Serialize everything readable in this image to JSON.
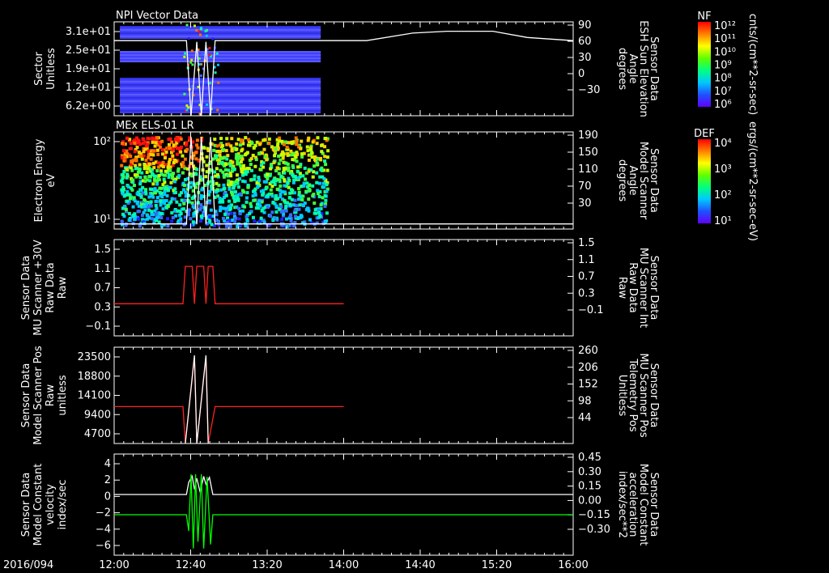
{
  "date_label": "2016/094",
  "x_ticks": [
    "12:00",
    "12:40",
    "13:20",
    "14:00",
    "14:40",
    "15:20",
    "16:00"
  ],
  "colors": {
    "white": "#ffffff",
    "red": "#ff2020",
    "green": "#00ff00"
  },
  "colorbars": [
    {
      "title": "NF",
      "ticks": [
        "10¹²",
        "10¹¹",
        "10¹⁰",
        "10⁹",
        "10⁸",
        "10⁷",
        "10⁶"
      ],
      "units": "cnts/(cm**2-sr-sec)"
    },
    {
      "title": "DEF",
      "ticks": [
        "10⁴",
        "10³",
        "10²",
        "10¹"
      ],
      "units": "ergs/(cm**2-sr-sec-eV)"
    }
  ],
  "chart_data": [
    {
      "type": "heatmap",
      "title": "NPI Vector Data",
      "ylabel": [
        "Sector",
        "Unitless"
      ],
      "yticks": [
        "3.1e+01",
        "2.5e+01",
        "1.9e+01",
        "1.2e+01",
        "6.2e+00"
      ],
      "ylabel_right": [
        "Sensor Data",
        "ESH Sun Elevation",
        "Angle",
        "degrees"
      ],
      "yticks_right": [
        "90",
        "60",
        "30",
        "0",
        "−30"
      ],
      "ylim_right": [
        -60,
        90
      ],
      "overlay_right": {
        "color": "white",
        "points": [
          [
            12,
            60
          ],
          [
            12.63,
            60
          ],
          [
            12.67,
            -60
          ],
          [
            12.72,
            58
          ],
          [
            12.76,
            -60
          ],
          [
            12.8,
            58
          ],
          [
            12.84,
            -60
          ],
          [
            12.88,
            60
          ],
          [
            14.2,
            60
          ],
          [
            14.6,
            72
          ],
          [
            14.9,
            75
          ],
          [
            15.3,
            75
          ],
          [
            15.6,
            65
          ],
          [
            16,
            60
          ]
        ]
      },
      "data_extent": [
        12.05,
        13.8
      ]
    },
    {
      "type": "heatmap",
      "title": "MEx ELS-01 LR",
      "ylabel": [
        "Electron Energy",
        "eV"
      ],
      "yticks": [
        "10²",
        "10¹"
      ],
      "ylabel_right": [
        "Sensor Data",
        "Model Scanner",
        "Angle",
        "degrees"
      ],
      "yticks_right": [
        "190",
        "150",
        "110",
        "70",
        "30"
      ],
      "ylim_right": [
        0,
        190
      ],
      "overlay_right": {
        "color": "white",
        "points": [
          [
            12,
            10
          ],
          [
            12.63,
            10
          ],
          [
            12.67,
            180
          ],
          [
            12.72,
            10
          ],
          [
            12.76,
            180
          ],
          [
            12.8,
            10
          ],
          [
            12.84,
            180
          ],
          [
            12.88,
            10
          ],
          [
            16,
            10
          ]
        ]
      },
      "data_extent": [
        12.05,
        13.85
      ]
    },
    {
      "type": "line",
      "ylabel": [
        "Sensor Data",
        "MU Scanner +30V",
        "Raw Data",
        "Raw"
      ],
      "yticks": [
        "1.5",
        "1.1",
        "0.7",
        "0.3",
        "−0.1"
      ],
      "ylim": [
        -0.3,
        1.5
      ],
      "ylabel_right": [
        "Sensor Data",
        "MU Scanner Int",
        "Raw Data",
        "Raw"
      ],
      "yticks_right": [
        "1.5",
        "1.1",
        "0.7",
        "0.3",
        "−0.1"
      ],
      "label_right_color": "red",
      "series": [
        {
          "color": "red",
          "points": [
            [
              12,
              0.3
            ],
            [
              12.6,
              0.3
            ],
            [
              12.62,
              1.0
            ],
            [
              12.68,
              1.0
            ],
            [
              12.7,
              0.3
            ],
            [
              12.72,
              1.0
            ],
            [
              12.78,
              1.0
            ],
            [
              12.8,
              0.3
            ],
            [
              12.82,
              1.0
            ],
            [
              12.86,
              1.0
            ],
            [
              12.88,
              0.3
            ],
            [
              14,
              0.3
            ]
          ]
        }
      ]
    },
    {
      "type": "line",
      "ylabel": [
        "Sensor Data",
        "Model Scanner Pos",
        "Raw",
        "unitless"
      ],
      "yticks": [
        "23500",
        "18800",
        "14100",
        "9400",
        "4700"
      ],
      "ylim": [
        0,
        23500
      ],
      "ylabel_right": [
        "Sensor Data",
        "MU Scanner Pos",
        "Telemetry Pos",
        "Unitless"
      ],
      "yticks_right": [
        "260",
        "206",
        "152",
        "98",
        "44"
      ],
      "label_right_color": "red",
      "series": [
        {
          "color": "red",
          "points": [
            [
              12,
              9000
            ],
            [
              12.6,
              9000
            ],
            [
              12.62,
              0
            ],
            [
              12.7,
              21000
            ],
            [
              12.72,
              0
            ],
            [
              12.8,
              21000
            ],
            [
              12.82,
              0
            ],
            [
              12.88,
              9000
            ],
            [
              14,
              9000
            ]
          ]
        },
        {
          "color": "white",
          "points": [
            [
              12.62,
              0
            ],
            [
              12.7,
              21500
            ],
            [
              12.72,
              0
            ],
            [
              12.8,
              21500
            ],
            [
              12.82,
              0
            ]
          ]
        }
      ]
    },
    {
      "type": "line",
      "ylabel": [
        "Sensor Data",
        "Model Constant",
        "velocity",
        "index/sec"
      ],
      "yticks": [
        "4",
        "2",
        "0",
        "−2",
        "−4",
        "−6"
      ],
      "ylim": [
        -6,
        4
      ],
      "ylabel_right": [
        "Sensor Data",
        "Model Constant",
        "acceleration",
        "index/sec**2"
      ],
      "yticks_right": [
        "0.45",
        "0.30",
        "0.15",
        "0.00",
        "−0.15",
        "−0.30"
      ],
      "ylim_right": [
        -0.3,
        0.45
      ],
      "label_right_color": "green",
      "series": [
        {
          "color": "white",
          "points": [
            [
              12,
              0
            ],
            [
              12.63,
              0
            ],
            [
              12.65,
              1.2
            ],
            [
              12.68,
              1.8
            ],
            [
              12.7,
              0.5
            ],
            [
              12.72,
              1.6
            ],
            [
              12.75,
              0.2
            ],
            [
              12.78,
              1.8
            ],
            [
              12.8,
              1.0
            ],
            [
              12.83,
              1.7
            ],
            [
              12.86,
              0
            ],
            [
              16,
              0
            ]
          ]
        },
        {
          "color": "green",
          "axis": "right",
          "points": [
            [
              12,
              0
            ],
            [
              12.63,
              0
            ],
            [
              12.65,
              -0.12
            ],
            [
              12.67,
              0.3
            ],
            [
              12.69,
              -0.25
            ],
            [
              12.71,
              0.3
            ],
            [
              12.73,
              -0.2
            ],
            [
              12.76,
              0.3
            ],
            [
              12.78,
              -0.25
            ],
            [
              12.81,
              0.28
            ],
            [
              12.84,
              -0.22
            ],
            [
              12.86,
              0
            ],
            [
              16,
              0
            ]
          ]
        }
      ]
    }
  ]
}
